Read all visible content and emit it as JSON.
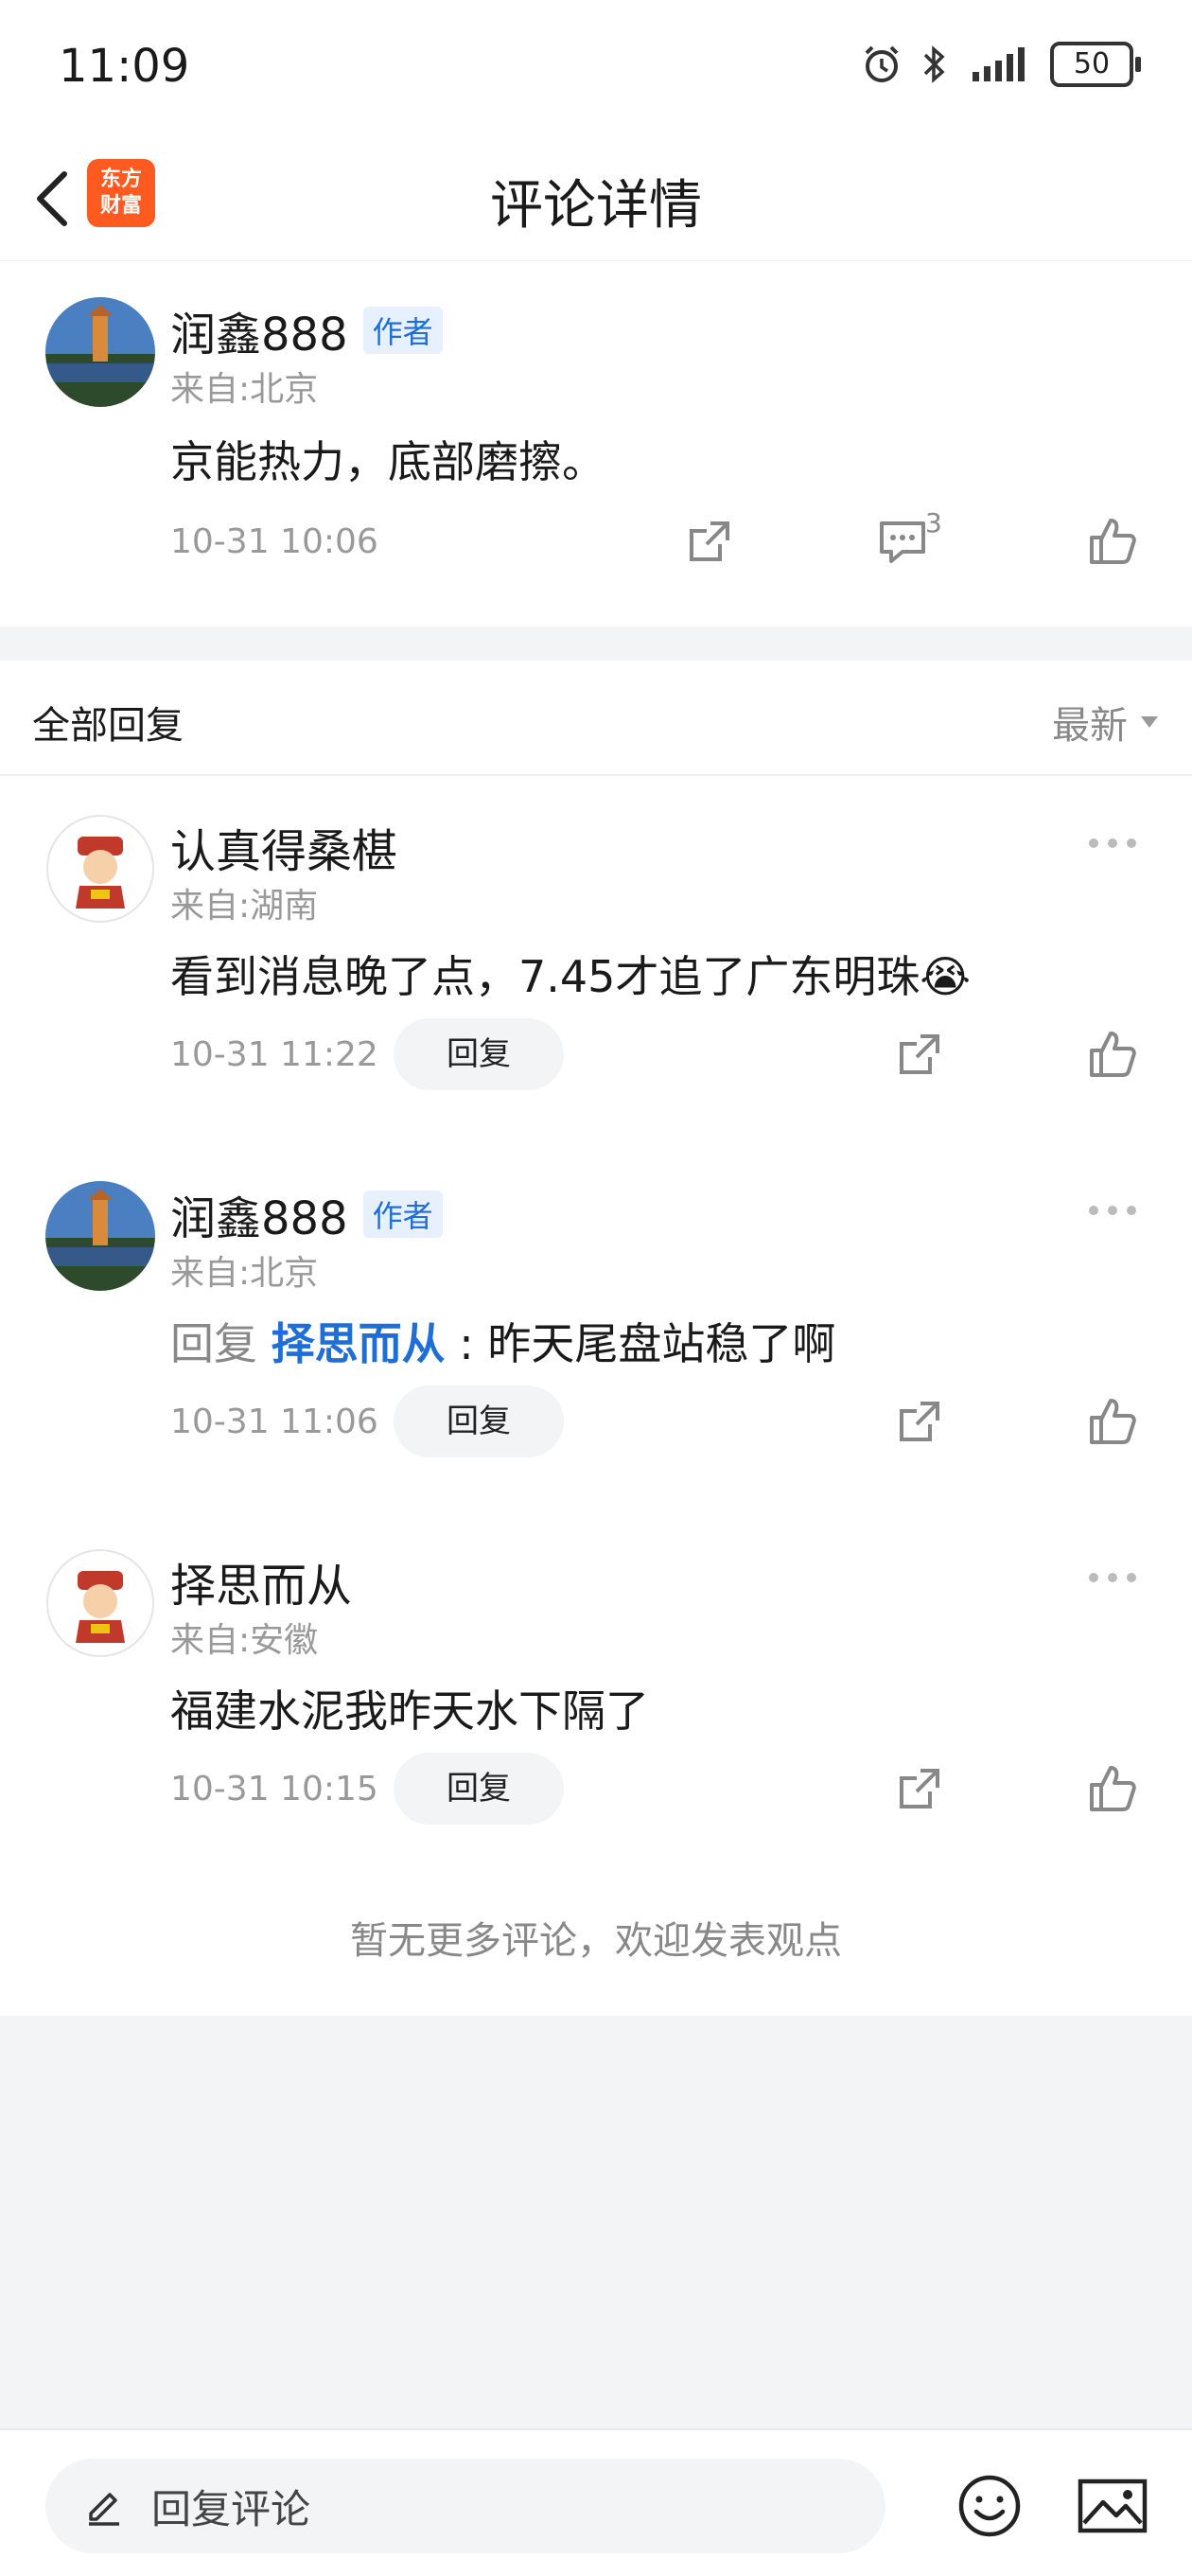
{
  "status_bar": {
    "time": "11:09",
    "battery": "50"
  },
  "header": {
    "title": "评论详情",
    "logo_line1": "东方",
    "logo_line2": "财富"
  },
  "main_comment": {
    "username": "润鑫888",
    "author_tag": "作者",
    "location": "来自:北京",
    "text": "京能热力，底部磨擦。",
    "time": "10-31 10:06",
    "reply_count": "3"
  },
  "replies_section": {
    "title": "全部回复",
    "sort_label": "最新"
  },
  "replies": [
    {
      "username": "认真得桑椹",
      "location": "来自:湖南",
      "text": "看到消息晚了点，7.45才追了广东明珠😭",
      "time": "10-31 11:22",
      "reply_label": "回复"
    },
    {
      "username": "润鑫888",
      "author_tag": "作者",
      "location": "来自:北京",
      "reply_prefix": "回复",
      "reply_target": "择思而从",
      "text": " : 昨天尾盘站稳了啊",
      "time": "10-31 11:06",
      "reply_label": "回复"
    },
    {
      "username": "择思而从",
      "location": "来自:安徽",
      "text": "福建水泥我昨天水下隔了",
      "time": "10-31 10:15",
      "reply_label": "回复"
    }
  ],
  "footer_note": "暂无更多评论，欢迎发表观点",
  "bottom_bar": {
    "placeholder": "回复评论"
  },
  "icons": {
    "share": "share-icon",
    "comment": "comment-icon",
    "like": "thumbs-up-icon",
    "more": "more-icon",
    "edit": "pencil-icon",
    "emoji": "emoji-icon",
    "image": "image-icon"
  },
  "colors": {
    "accent_blue": "#1f6dd6",
    "brand_orange": "#ff5a1f",
    "background": "#f3f4f6"
  }
}
